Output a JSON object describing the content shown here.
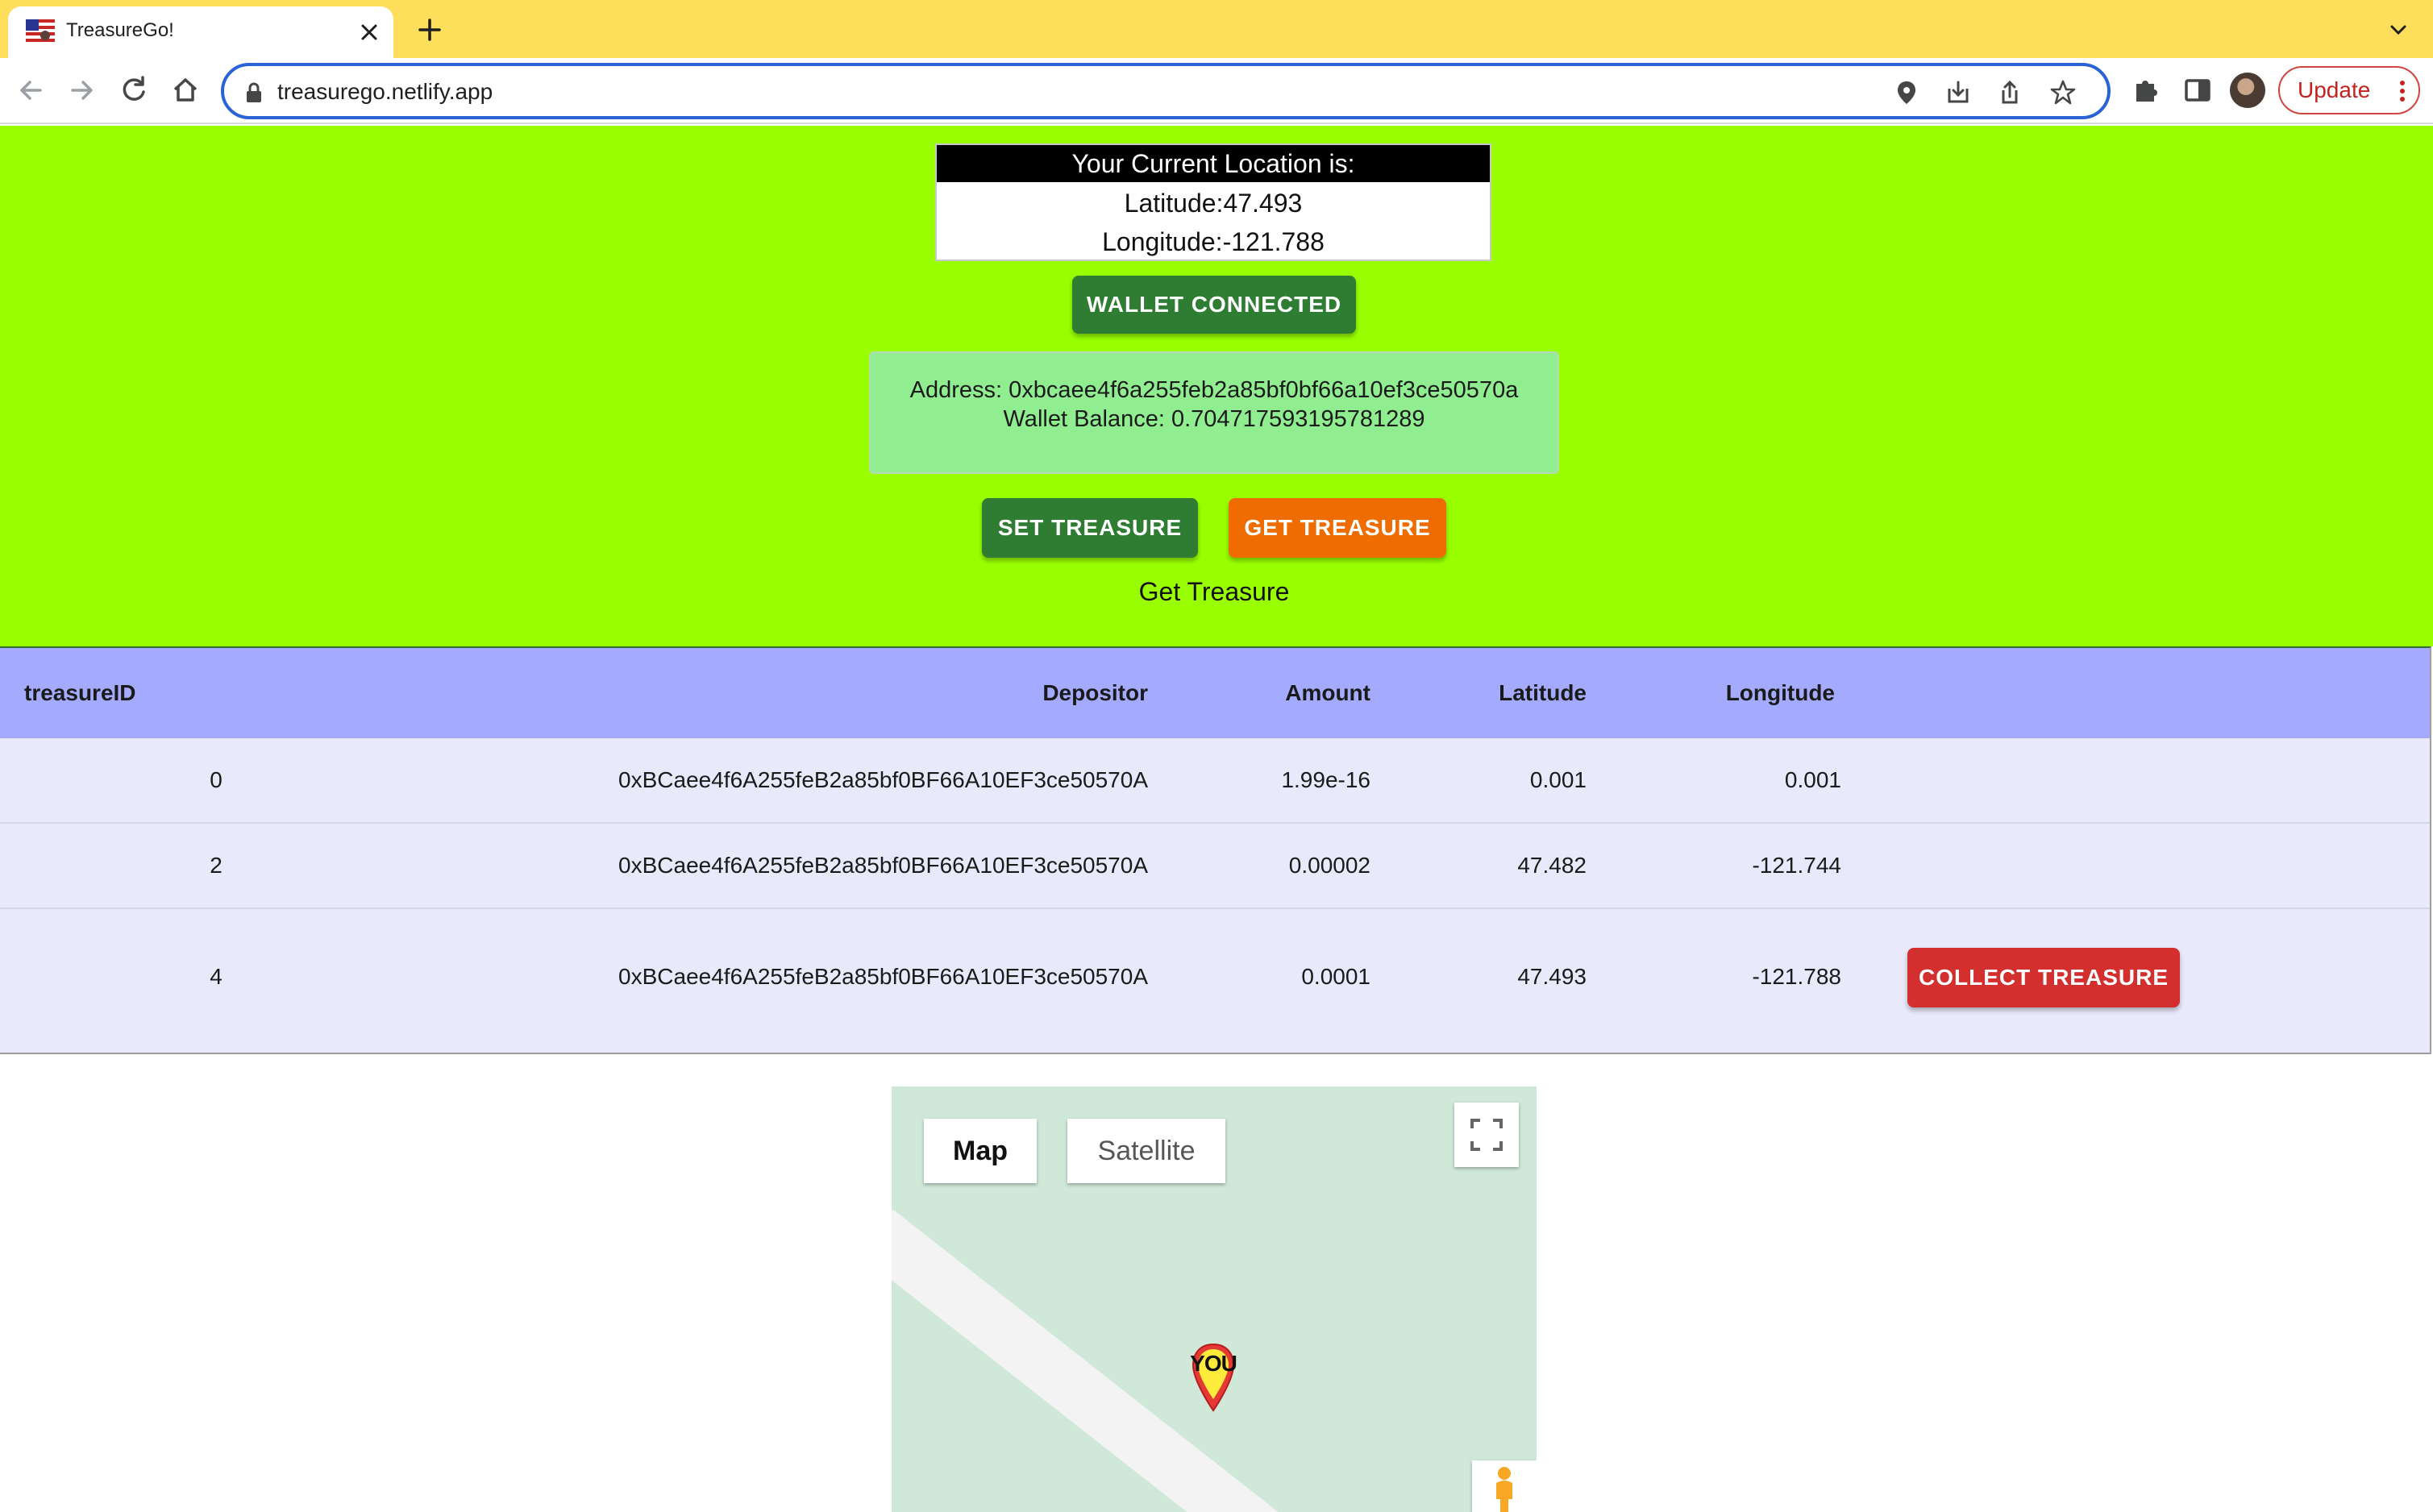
{
  "browser": {
    "tab_title": "TreasureGo!",
    "url": "treasurego.netlify.app",
    "update_label": "Update"
  },
  "location": {
    "header": "Your Current Location is:",
    "latitude": "Latitude:47.493",
    "longitude": "Longitude:-121.788"
  },
  "wallet": {
    "button_label": "WALLET CONNECTED",
    "address": "Address: 0xbcaee4f6a255feb2a85bf0bf66a10ef3ce50570a",
    "balance": "Wallet Balance: 0.704717593195781289"
  },
  "actions": {
    "set_label": "SET TREASURE",
    "get_label": "GET TREASURE",
    "caption": "Get Treasure"
  },
  "table": {
    "headers": [
      "treasureID",
      "Depositor",
      "Amount",
      "Latitude",
      "Longitude"
    ],
    "rows": [
      {
        "id": "0",
        "depositor": "0xBCaee4f6A255feB2a85bf0BF66A10EF3ce50570A",
        "amount": "1.99e-16",
        "latitude": "0.001",
        "longitude": "0.001"
      },
      {
        "id": "2",
        "depositor": "0xBCaee4f6A255feB2a85bf0BF66A10EF3ce50570A",
        "amount": "0.00002",
        "latitude": "47.482",
        "longitude": "-121.744"
      },
      {
        "id": "4",
        "depositor": "0xBCaee4f6A255feB2a85bf0BF66A10EF3ce50570A",
        "amount": "0.0001",
        "latitude": "47.493",
        "longitude": "-121.788",
        "action": "COLLECT TREASURE"
      }
    ]
  },
  "map": {
    "type_map": "Map",
    "type_satellite": "Satellite",
    "marker_label": "YOU"
  },
  "colors": {
    "hero_bg": "#99ff00",
    "table_header_bg": "#a4abff",
    "table_body_bg": "#e8eafc",
    "wallet_info_bg": "#90ee90",
    "success_button": "#2e7d32",
    "warning_button": "#ef6c00",
    "error_button": "#d32f2f",
    "tab_strip": "#ffde5c"
  },
  "icons": [
    "flag-favicon-icon",
    "close-icon",
    "plus-icon",
    "chevron-down-icon",
    "back-arrow-icon",
    "forward-arrow-icon",
    "reload-icon",
    "home-icon",
    "lock-icon",
    "location-pin-icon",
    "install-icon",
    "share-icon",
    "star-icon",
    "puzzle-icon",
    "side-panel-icon",
    "kebab-menu-icon",
    "fullscreen-icon",
    "pegman-icon",
    "map-marker-icon"
  ]
}
